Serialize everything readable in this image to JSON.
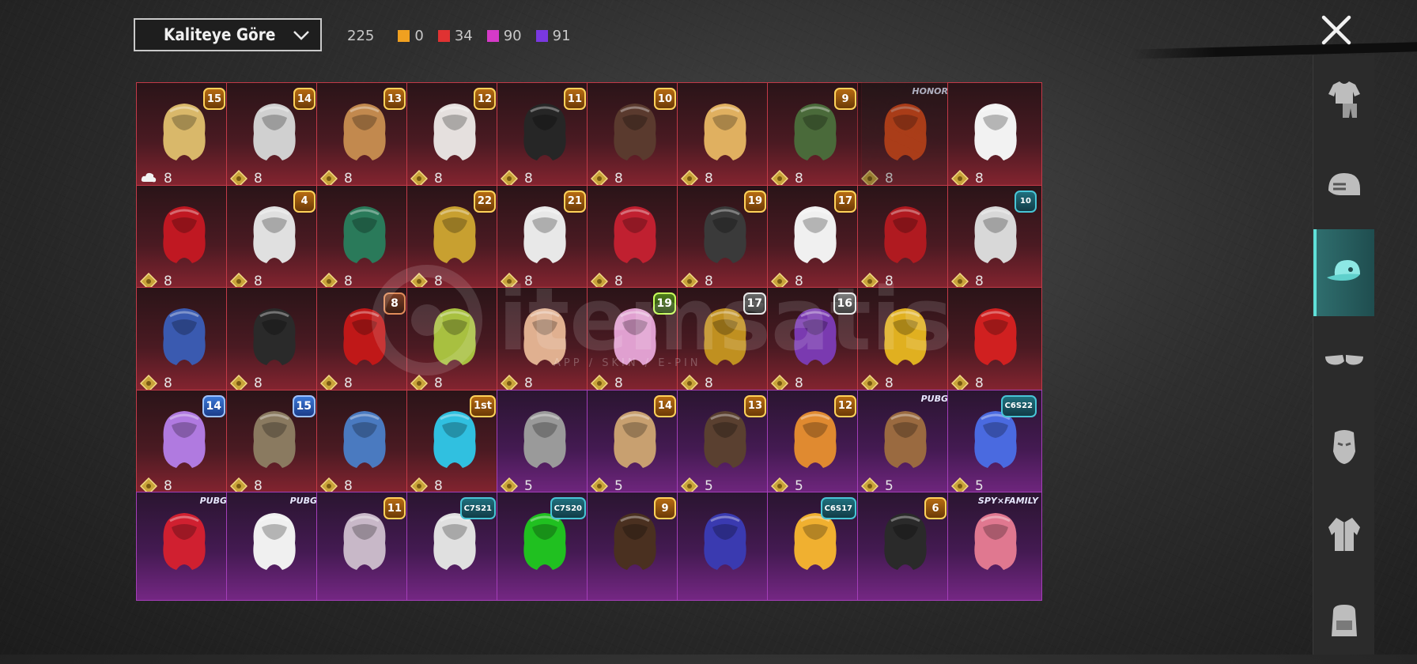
{
  "toolbar": {
    "sort_label": "Kaliteye Göre",
    "total_count": "225",
    "counts": [
      {
        "value": "0",
        "color": "#f0a020"
      },
      {
        "value": "34",
        "color": "#e03232"
      },
      {
        "value": "90",
        "color": "#d63ac8"
      },
      {
        "value": "91",
        "color": "#7a38e0"
      }
    ]
  },
  "close_icon": "close-icon",
  "side_tabs": [
    {
      "icon": "outfit-icon",
      "active": false
    },
    {
      "icon": "helmet-icon",
      "active": false
    },
    {
      "icon": "cap-icon",
      "active": true
    },
    {
      "icon": "glasses-icon",
      "active": false
    },
    {
      "icon": "mask-icon",
      "active": false
    },
    {
      "icon": "jacket-icon",
      "active": false
    },
    {
      "icon": "backpack-icon",
      "active": false
    }
  ],
  "watermark": {
    "text": "itemsatis",
    "sub": "APP / SKIN / E-PIN"
  },
  "items": [
    {
      "badge": "15",
      "style": "gold",
      "price": "8",
      "rarity": "red",
      "hue": "#d9b86a",
      "icon": "cloud-icon"
    },
    {
      "badge": "14",
      "style": "gold",
      "price": "8",
      "rarity": "red",
      "hue": "#d0d0d0"
    },
    {
      "badge": "13",
      "style": "gold",
      "price": "8",
      "rarity": "red",
      "hue": "#c2894e"
    },
    {
      "badge": "12",
      "style": "gold",
      "price": "8",
      "rarity": "red",
      "hue": "#e5e0de"
    },
    {
      "badge": "11",
      "style": "gold",
      "price": "8",
      "rarity": "red",
      "hue": "#262626"
    },
    {
      "badge": "10",
      "style": "gold",
      "price": "8",
      "rarity": "red",
      "hue": "#5a3a2e"
    },
    {
      "badge": "",
      "style": "",
      "price": "8",
      "rarity": "red",
      "hue": "#e0b060"
    },
    {
      "badge": "9",
      "style": "gold",
      "price": "8",
      "rarity": "red",
      "hue": "#4a6a3a"
    },
    {
      "brand": "HONOR",
      "price": "8",
      "rarity": "red",
      "hue": "#e24a18",
      "dim": true
    },
    {
      "badge": "",
      "style": "",
      "price": "8",
      "rarity": "red",
      "hue": "#f2f2f2"
    },
    {
      "badge": "",
      "style": "",
      "price": "8",
      "rarity": "red",
      "hue": "#c01822"
    },
    {
      "badge": "4",
      "style": "gold",
      "price": "8",
      "rarity": "red",
      "hue": "#e0e0e0"
    },
    {
      "badge": "",
      "style": "",
      "price": "8",
      "rarity": "red",
      "hue": "#2a7a5a"
    },
    {
      "badge": "22",
      "style": "gold",
      "price": "8",
      "rarity": "red",
      "hue": "#c8a030"
    },
    {
      "badge": "21",
      "style": "gold",
      "price": "8",
      "rarity": "red",
      "hue": "#e8e8e8"
    },
    {
      "badge": "",
      "style": "",
      "price": "8",
      "rarity": "red",
      "hue": "#c02030"
    },
    {
      "badge": "19",
      "style": "gold",
      "price": "8",
      "rarity": "red",
      "hue": "#3a3a3a"
    },
    {
      "badge": "17",
      "style": "gold",
      "price": "8",
      "rarity": "red",
      "hue": "#f0f0f0"
    },
    {
      "badge": "",
      "style": "",
      "price": "8",
      "rarity": "red",
      "hue": "#b01a20"
    },
    {
      "badge": "10",
      "style": "teal",
      "price": "8",
      "rarity": "red",
      "hue": "#d8d8d8"
    },
    {
      "badge": "",
      "style": "",
      "price": "8",
      "rarity": "red",
      "hue": "#3a5ab0"
    },
    {
      "badge": "",
      "style": "",
      "price": "8",
      "rarity": "red",
      "hue": "#2a2a2a"
    },
    {
      "badge": "8",
      "style": "copper",
      "price": "8",
      "rarity": "red",
      "hue": "#c01818"
    },
    {
      "badge": "",
      "style": "",
      "price": "8",
      "rarity": "red",
      "hue": "#a8c040"
    },
    {
      "badge": "",
      "style": "",
      "price": "8",
      "rarity": "red",
      "hue": "#e0b090"
    },
    {
      "badge": "19",
      "style": "lime",
      "price": "8",
      "rarity": "red",
      "hue": "#e0a0d0"
    },
    {
      "badge": "17",
      "style": "white",
      "price": "8",
      "rarity": "red",
      "hue": "#c09020"
    },
    {
      "badge": "16",
      "style": "white",
      "price": "8",
      "rarity": "red",
      "hue": "#7a3ab0"
    },
    {
      "badge": "",
      "style": "",
      "price": "8",
      "rarity": "red",
      "hue": "#e0b020"
    },
    {
      "badge": "",
      "style": "",
      "price": "8",
      "rarity": "red",
      "hue": "#d02020"
    },
    {
      "badge": "14",
      "style": "blue",
      "price": "8",
      "rarity": "red",
      "hue": "#b07ae0"
    },
    {
      "badge": "15",
      "style": "blue",
      "price": "8",
      "rarity": "red",
      "hue": "#8a7a60"
    },
    {
      "badge": "",
      "style": "",
      "price": "8",
      "rarity": "red",
      "hue": "#4a7ac0"
    },
    {
      "badge": "1st",
      "style": "gold",
      "price": "8",
      "rarity": "red",
      "hue": "#30c0e0"
    },
    {
      "badge": "",
      "style": "",
      "price": "5",
      "rarity": "purple",
      "hue": "#9a9a9a"
    },
    {
      "badge": "14",
      "style": "gold",
      "price": "5",
      "rarity": "purple",
      "hue": "#c8a070"
    },
    {
      "badge": "13",
      "style": "gold",
      "price": "5",
      "rarity": "purple",
      "hue": "#5a4030"
    },
    {
      "badge": "12",
      "style": "gold",
      "price": "5",
      "rarity": "purple",
      "hue": "#e08a30"
    },
    {
      "brand": "PUBG",
      "price": "5",
      "rarity": "purple",
      "hue": "#9a6a40"
    },
    {
      "badge": "C6S22",
      "style": "teal",
      "price": "5",
      "rarity": "purple",
      "hue": "#4a6ae0"
    },
    {
      "brand": "PUBG",
      "price": "",
      "rarity": "purple",
      "hue": "#d02030"
    },
    {
      "brand": "PUBG",
      "price": "",
      "rarity": "purple",
      "hue": "#f0f0f0"
    },
    {
      "badge": "11",
      "style": "gold",
      "price": "",
      "rarity": "purple",
      "hue": "#c8b8c8"
    },
    {
      "badge": "C7S21",
      "style": "teal",
      "price": "",
      "rarity": "purple",
      "hue": "#e0e0e0"
    },
    {
      "badge": "C7S20",
      "style": "teal",
      "price": "",
      "rarity": "purple",
      "hue": "#20c020"
    },
    {
      "badge": "9",
      "style": "gold",
      "price": "",
      "rarity": "purple",
      "hue": "#4a3020"
    },
    {
      "badge": "",
      "style": "",
      "price": "",
      "rarity": "purple",
      "hue": "#3a3ab0"
    },
    {
      "badge": "C6S17",
      "style": "teal",
      "price": "",
      "rarity": "purple",
      "hue": "#f0b030"
    },
    {
      "badge": "6",
      "style": "gold",
      "price": "",
      "rarity": "purple",
      "hue": "#2a2a2a"
    },
    {
      "brand": "SPY×FAMILY",
      "price": "",
      "rarity": "purple",
      "hue": "#e07890"
    }
  ]
}
